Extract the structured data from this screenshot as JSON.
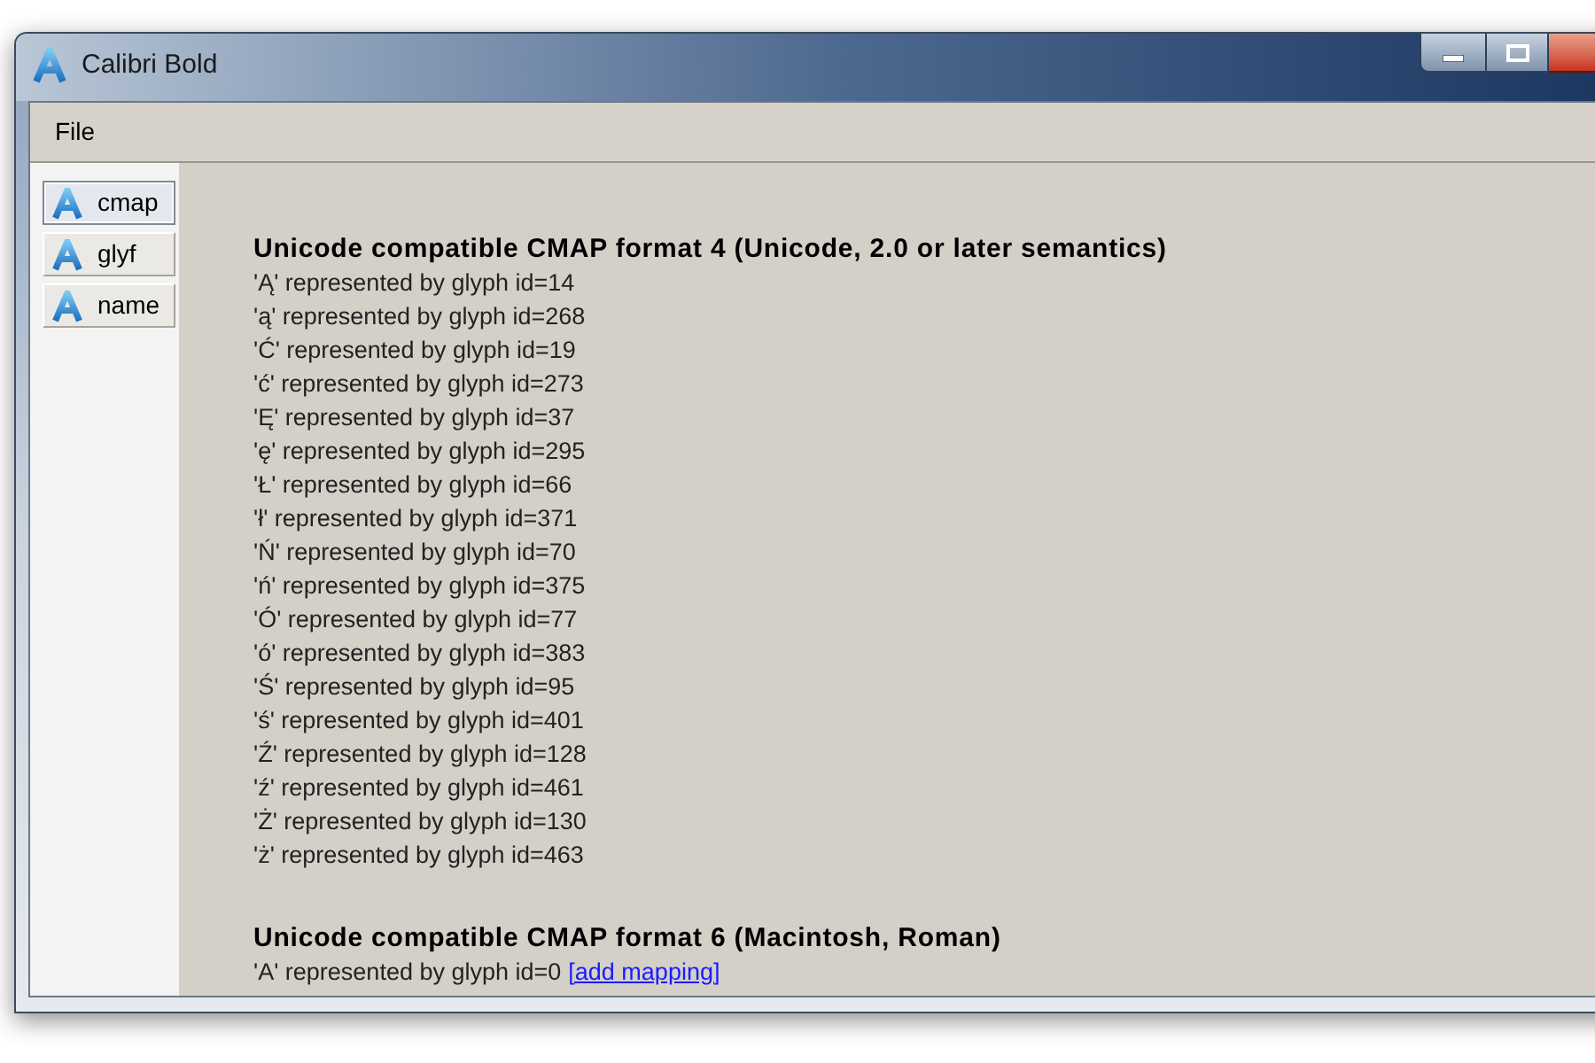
{
  "window": {
    "title": "Calibri Bold"
  },
  "menu": [
    {
      "label": "File"
    }
  ],
  "sidebar": {
    "items": [
      {
        "label": "cmap",
        "selected": true
      },
      {
        "label": "glyf",
        "selected": false
      },
      {
        "label": "name",
        "selected": false
      }
    ]
  },
  "sections": [
    {
      "heading": "Unicode compatible CMAP format 4 (Unicode, 2.0 or later semantics)",
      "lines": [
        {
          "text": "'Ą' represented by glyph id=14"
        },
        {
          "text": "'ą' represented by glyph id=268"
        },
        {
          "text": "'Ć' represented by glyph id=19"
        },
        {
          "text": "'ć' represented by glyph id=273"
        },
        {
          "text": "'Ę' represented by glyph id=37"
        },
        {
          "text": "'ę' represented by glyph id=295"
        },
        {
          "text": "'Ł' represented by glyph id=66"
        },
        {
          "text": "'ł' represented by glyph id=371"
        },
        {
          "text": "'Ń' represented by glyph id=70"
        },
        {
          "text": "'ń' represented by glyph id=375"
        },
        {
          "text": "'Ó' represented by glyph id=77"
        },
        {
          "text": "'ó' represented by glyph id=383"
        },
        {
          "text": "'Ś' represented by glyph id=95"
        },
        {
          "text": "'ś' represented by glyph id=401"
        },
        {
          "text": "'Ź' represented by glyph id=128"
        },
        {
          "text": "'ź' represented by glyph id=461"
        },
        {
          "text": "'Ż' represented by glyph id=130"
        },
        {
          "text": "'ż' represented by glyph id=463"
        }
      ]
    },
    {
      "heading": "Unicode compatible CMAP format 6 (Macintosh, Roman)",
      "lines": [
        {
          "text": "'A' represented by glyph id=0",
          "link": "[add mapping]"
        }
      ]
    }
  ]
}
